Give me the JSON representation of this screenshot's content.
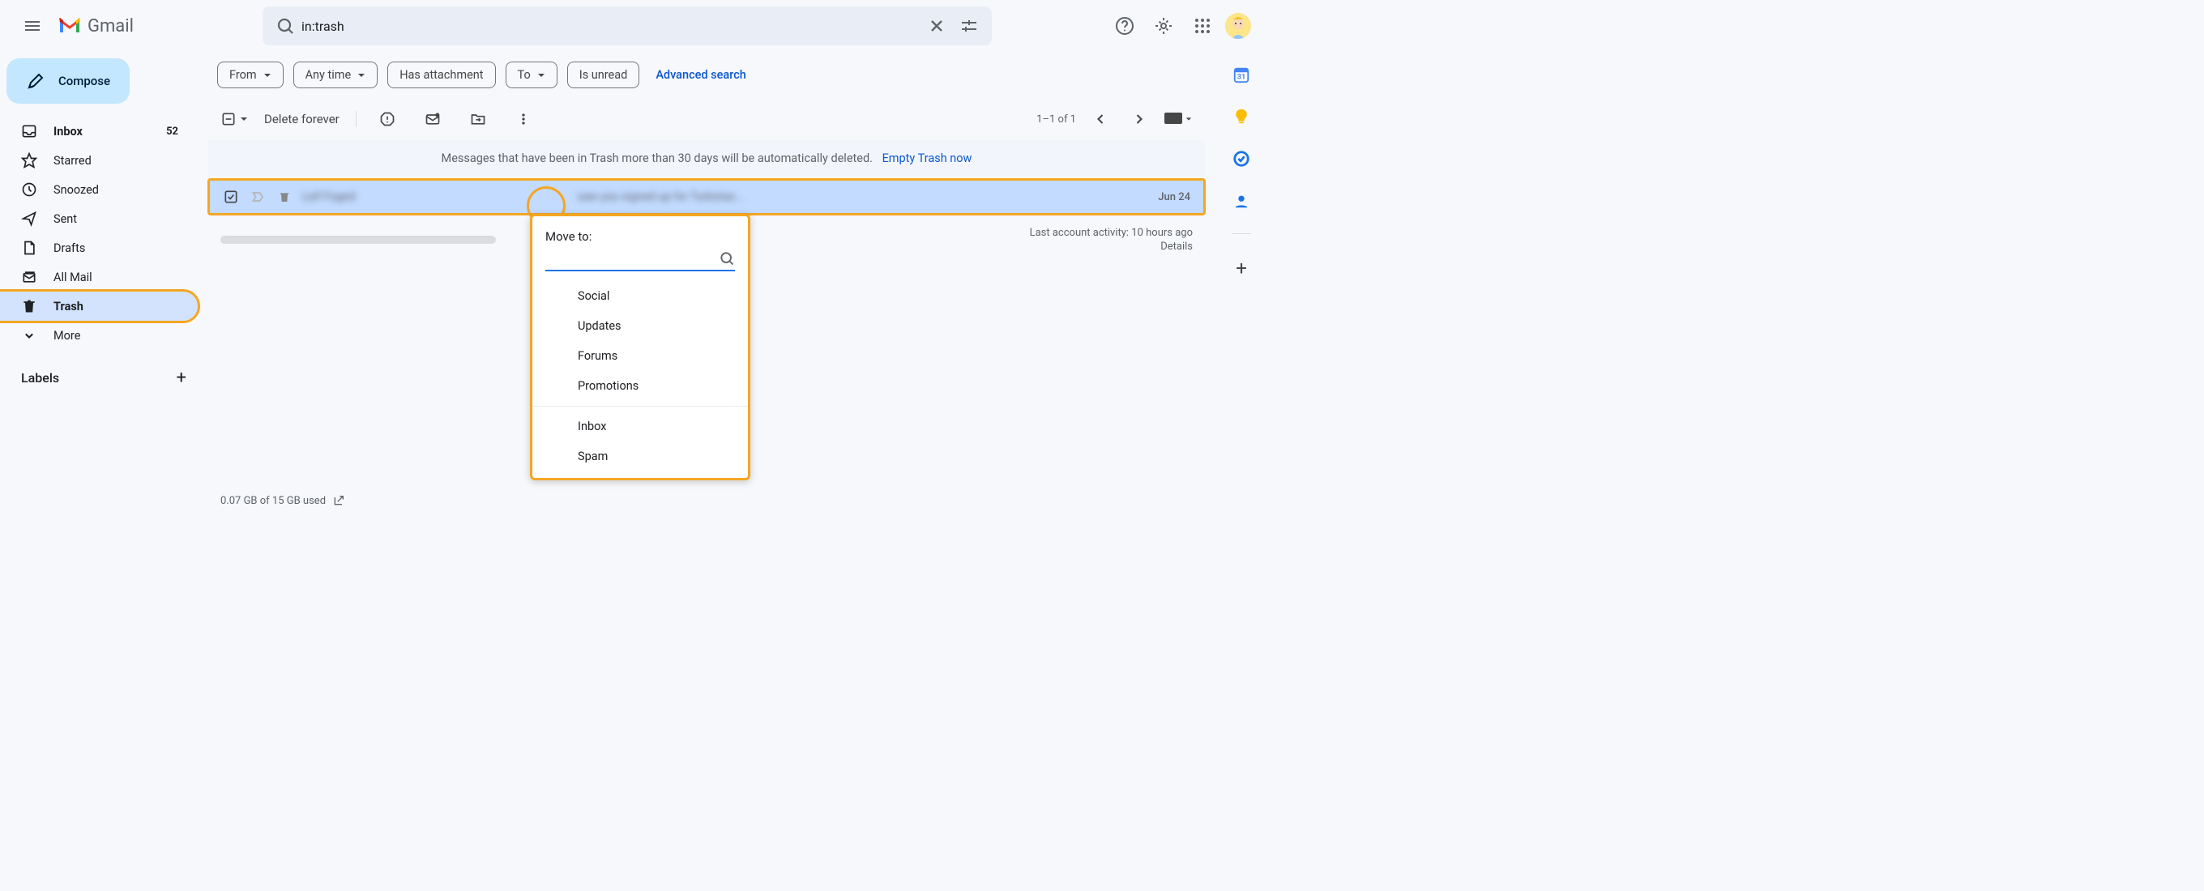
{
  "header": {
    "brand": "Gmail",
    "search_value": "in:trash"
  },
  "sidebar": {
    "compose": "Compose",
    "items": [
      {
        "label": "Inbox",
        "count": "52"
      },
      {
        "label": "Starred"
      },
      {
        "label": "Snoozed"
      },
      {
        "label": "Sent"
      },
      {
        "label": "Drafts"
      },
      {
        "label": "All Mail"
      },
      {
        "label": "Trash"
      },
      {
        "label": "More"
      }
    ],
    "labels_header": "Labels"
  },
  "filters": {
    "from": "From",
    "any_time": "Any time",
    "has_attachment": "Has attachment",
    "to": "To",
    "is_unread": "Is unread",
    "advanced": "Advanced search"
  },
  "toolbar": {
    "delete_forever": "Delete forever",
    "page_info": "1–1 of 1"
  },
  "banner": {
    "text": "Messages that have been in Trash more than 30 days will be automatically deleted.",
    "empty": "Empty Trash now"
  },
  "email": {
    "sender": "Leif Foged",
    "preview": "saw you signed up for Turbotax...",
    "date": "Jun 24"
  },
  "moveto": {
    "title": "Move to:",
    "groups": [
      [
        "Social",
        "Updates",
        "Forums",
        "Promotions"
      ],
      [
        "Inbox",
        "Spam"
      ]
    ]
  },
  "footer": {
    "storage": "0.07 GB of 15 GB used",
    "activity": "Last account activity: 10 hours ago",
    "details": "Details"
  }
}
